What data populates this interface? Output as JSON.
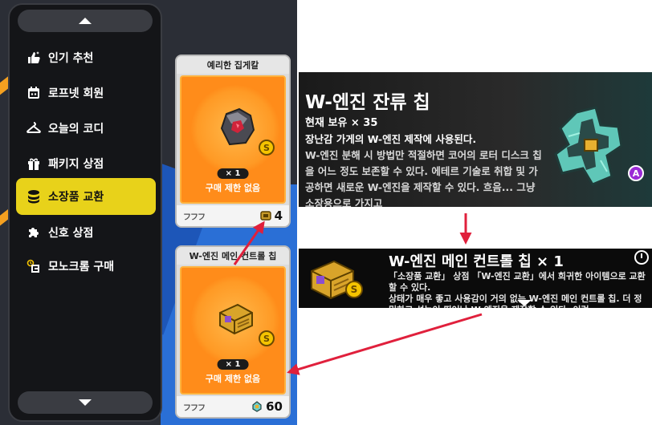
{
  "sidebar": {
    "items": [
      {
        "label": "인기 추천",
        "icon": "thumbs-up-icon",
        "active": false
      },
      {
        "label": "로프넷 회원",
        "icon": "calendar-icon",
        "active": false
      },
      {
        "label": "오늘의 코디",
        "icon": "hanger-icon",
        "active": false
      },
      {
        "label": "패키지 상점",
        "icon": "gift-icon",
        "active": false
      },
      {
        "label": "소장품 교환",
        "icon": "coin-stack-icon",
        "active": true
      },
      {
        "label": "신호 상점",
        "icon": "puzzle-icon",
        "active": false
      },
      {
        "label": "모노크롬 구매",
        "icon": "timer-box-icon",
        "active": false
      }
    ]
  },
  "cards": [
    {
      "title": "예리한 집게칼",
      "quantity": "× 1",
      "limit": "구매 제한 없음",
      "brand": "フフフ",
      "price": "4",
      "coin_label": "S"
    },
    {
      "title": "W-엔진 메인 컨트롤 칩",
      "quantity": "× 1",
      "limit": "구매 제한 없음",
      "brand": "フフフ",
      "price": "60",
      "coin_label": "S"
    }
  ],
  "detail": {
    "name": "W-엔진 잔류 칩",
    "owned": "현재 보유 × 35",
    "desc_first": "장난감 가게의 W-엔진 제작에 사용된다.",
    "desc_rest": "W-엔진 분해 시 방법만 적절하면 코어의 로터 디스크 칩을 어느 정도 보존할 수 있다. 에테르 기술로 취합 및 가공하면 새로운 W-엔진을 제작할 수 있다. 흐음... 그냥 소장용으로 가지고",
    "rank": "A"
  },
  "reward": {
    "name": "W-엔진 메인 컨트롤 칩 × 1",
    "coin_label": "S",
    "desc_line1": "「소장품 교환」 상점 「W-엔진 교환」에서 희귀한 아이템으로 교환할 수 있다.",
    "desc_line2": "상태가 매우 좋고 사용감이 거의 없는 W-엔진 메인 컨트롤 칩. 더 정밀하고 성능이 뛰어난 W-엔진을 제작할 수 있다. 이런"
  },
  "colors": {
    "accent_yellow": "#e8d21a",
    "card_orange": "#ff8c1a",
    "arrow_red": "#e0203c",
    "rank_purple": "#9b2bd6"
  }
}
